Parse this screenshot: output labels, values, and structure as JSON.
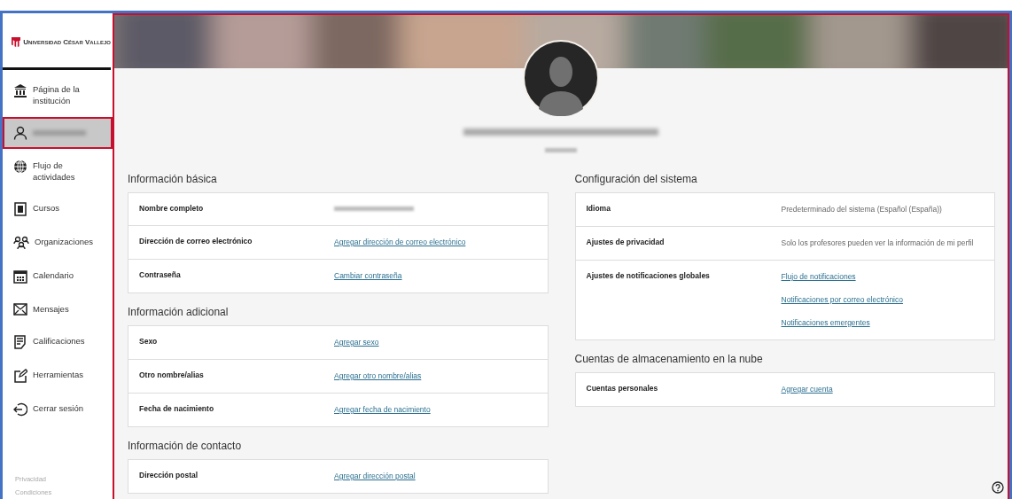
{
  "sidebar": {
    "logo_text": "Universidad César Vallejo",
    "items": [
      {
        "kind": "nav",
        "label": "Página de la institución",
        "selected": false
      },
      {
        "kind": "profile",
        "selected": true
      },
      {
        "kind": "nav",
        "label": "Flujo de actividades",
        "selected": false
      },
      {
        "kind": "nav",
        "label": "Cursos",
        "selected": false
      },
      {
        "kind": "nav",
        "label": "Organizaciones",
        "selected": false
      },
      {
        "kind": "nav",
        "label": "Calendario",
        "selected": false
      },
      {
        "kind": "nav",
        "label": "Mensajes",
        "selected": false
      },
      {
        "kind": "nav",
        "label": "Calificaciones",
        "selected": false
      },
      {
        "kind": "nav",
        "label": "Herramientas",
        "selected": false
      },
      {
        "kind": "nav",
        "label": "Cerrar sesión",
        "selected": false
      }
    ],
    "footer_links": [
      "Privacidad",
      "Condiciones"
    ]
  },
  "profile": {
    "kind": "picture"
  },
  "columns": [
    [
      {
        "title": "Información básica",
        "rows": [
          {
            "label": "Nombre completo",
            "kind": "blurred"
          },
          {
            "label": "Dirección de correo electrónico",
            "kind": "link",
            "values": [
              "Agregar dirección de correo electrónico"
            ]
          },
          {
            "label": "Contraseña",
            "kind": "link",
            "values": [
              "Cambiar contraseña"
            ]
          }
        ]
      },
      {
        "title": "Información adicional",
        "rows": [
          {
            "label": "Sexo",
            "kind": "link",
            "values": [
              "Agregar sexo"
            ]
          },
          {
            "label": "Otro nombre/alias",
            "kind": "link",
            "values": [
              "Agregar otro nombre/alias"
            ]
          },
          {
            "label": "Fecha de nacimiento",
            "kind": "link",
            "values": [
              "Agregar fecha de nacimiento"
            ]
          }
        ]
      },
      {
        "title": "Información de contacto",
        "rows": [
          {
            "label": "Dirección postal",
            "kind": "link",
            "values": [
              "Agregar dirección postal"
            ]
          }
        ]
      }
    ],
    [
      {
        "title": "Configuración del sistema",
        "rows": [
          {
            "label": "Idioma",
            "kind": "text",
            "values": [
              "Predeterminado del sistema (Español (España))"
            ]
          },
          {
            "label": "Ajustes de privacidad",
            "kind": "text",
            "values": [
              "Solo los profesores pueden ver la información de mi perfil"
            ]
          },
          {
            "label": "Ajustes de notificaciones globales",
            "kind": "link",
            "values": [
              "Flujo de notificaciones",
              "Notificaciones por correo electrónico",
              "Notificaciones emergentes"
            ]
          }
        ]
      },
      {
        "title": "Cuentas de almacenamiento en la nube",
        "rows": [
          {
            "label": "Cuentas personales",
            "kind": "link",
            "values": [
              "Agregar cuenta"
            ]
          }
        ]
      }
    ]
  ]
}
